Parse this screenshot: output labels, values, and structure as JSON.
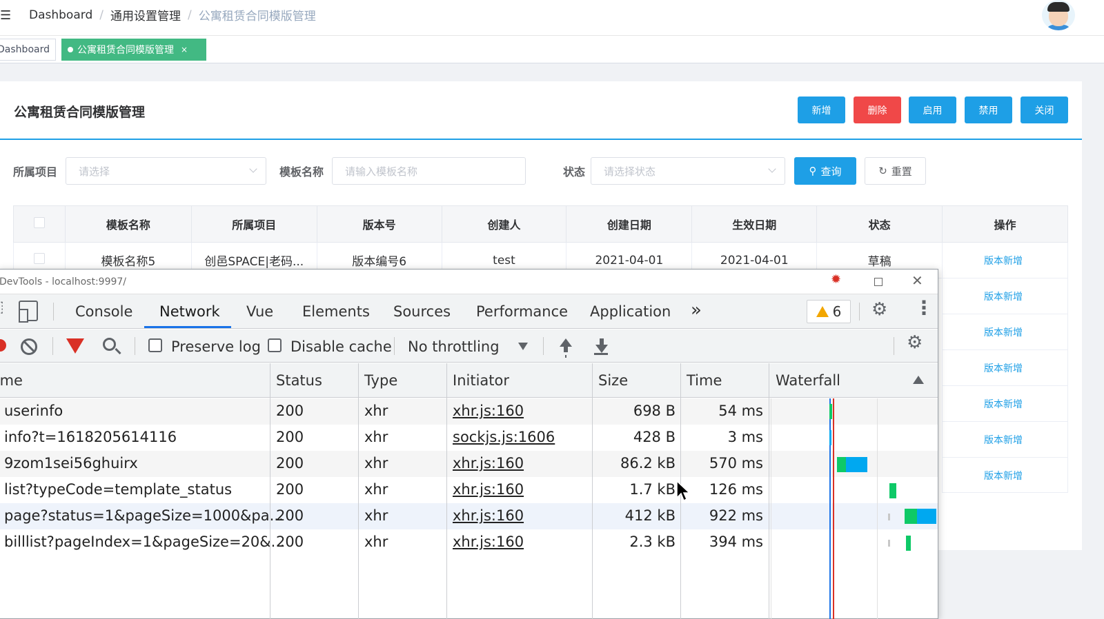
{
  "header": {
    "breadcrumb": [
      "Dashboard",
      "通用设置管理",
      "公寓租赁合同模版管理"
    ]
  },
  "tags": {
    "dashboard": "Dashboard",
    "active": "公寓租赁合同模版管理",
    "close": "×"
  },
  "page": {
    "title": "公寓租赁合同模版管理",
    "buttons": {
      "add": "新增",
      "delete": "删除",
      "enable": "启用",
      "disable": "禁用",
      "close": "关闭"
    }
  },
  "filters": {
    "project_label": "所属项目",
    "project_placeholder": "请选择",
    "name_label": "模板名称",
    "name_placeholder": "请输入模板名称",
    "status_label": "状态",
    "status_placeholder": "请选择状态",
    "query": "查询",
    "reset": "重置"
  },
  "table": {
    "columns": [
      "模板名称",
      "所属项目",
      "版本号",
      "创建人",
      "创建日期",
      "生效日期",
      "状态",
      "操作"
    ],
    "first_row": [
      "模板名称5",
      "创邑SPACE|老码...",
      "版本编号6",
      "test",
      "2021-04-01",
      "2021-04-01",
      "草稿"
    ],
    "op_link": "版本新增"
  },
  "devtools": {
    "title": "DevTools - localhost:9997/",
    "tabs": [
      "Console",
      "Network",
      "Vue",
      "Elements",
      "Sources",
      "Performance",
      "Application"
    ],
    "more": "»",
    "warnings": "6",
    "toolbar": {
      "preserve_log": "Preserve log",
      "disable_cache": "Disable cache",
      "throttling": "No throttling"
    },
    "columns": {
      "name": "Name",
      "status": "Status",
      "type": "Type",
      "initiator": "Initiator",
      "size": "Size",
      "time": "Time",
      "waterfall": "Waterfall"
    },
    "rows": [
      {
        "name": "userinfo",
        "status": "200",
        "type": "xhr",
        "initiator": "xhr.js:160",
        "size": "698 B",
        "time": "54 ms"
      },
      {
        "name": "info?t=1618205614116",
        "status": "200",
        "type": "xhr",
        "initiator": "sockjs.js:1606",
        "size": "428 B",
        "time": "3 ms"
      },
      {
        "name": "9zom1sei56ghuirx",
        "status": "200",
        "type": "xhr",
        "initiator": "xhr.js:160",
        "size": "86.2 kB",
        "time": "570 ms"
      },
      {
        "name": "list?typeCode=template_status",
        "status": "200",
        "type": "xhr",
        "initiator": "xhr.js:160",
        "size": "1.7 kB",
        "time": "126 ms"
      },
      {
        "name": "page?status=1&pageSize=1000&pa...",
        "status": "200",
        "type": "xhr",
        "initiator": "xhr.js:160",
        "size": "412 kB",
        "time": "922 ms"
      },
      {
        "name": "billlist?pageIndex=1&pageSize=20&...",
        "status": "200",
        "type": "xhr",
        "initiator": "xhr.js:160",
        "size": "2.3 kB",
        "time": "394 ms"
      }
    ]
  },
  "colors": {
    "primary": "#1e9fe6",
    "danger": "#f04848",
    "tag_active": "#42b983",
    "devtools_accent": "#1a73e8",
    "waterfall_green": "#0ec967",
    "waterfall_blue": "#00a8f0"
  }
}
